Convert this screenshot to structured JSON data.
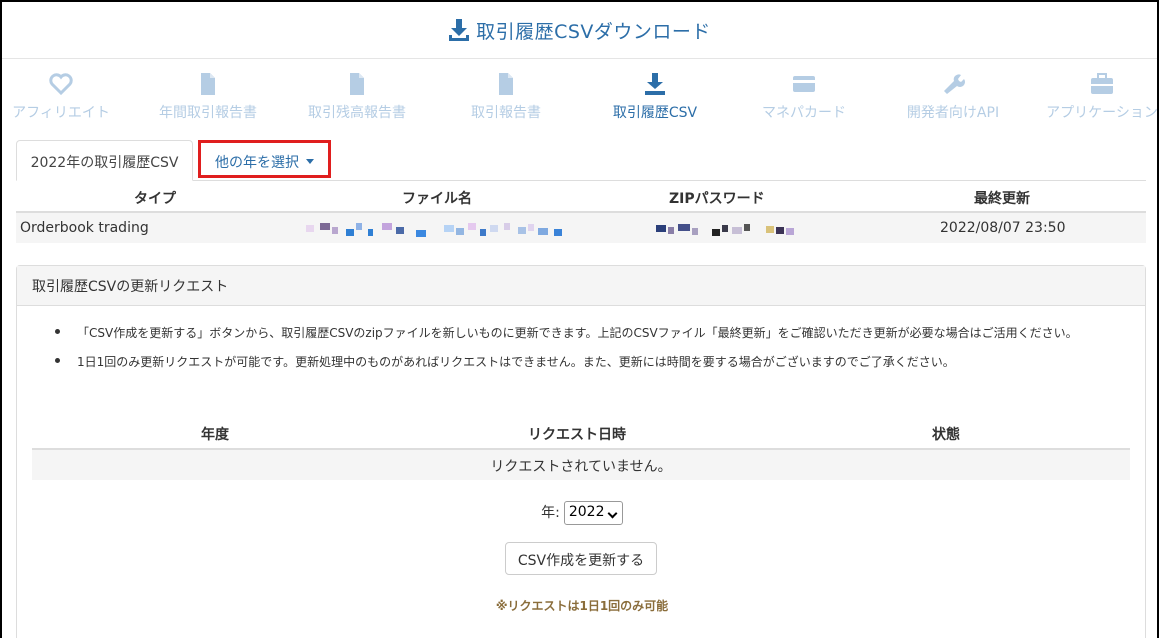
{
  "title": "取引履歴CSVダウンロード",
  "nav": [
    {
      "label": "アフィリエイト",
      "icon": "heart-icon"
    },
    {
      "label": "年間取引報告書",
      "icon": "document-icon"
    },
    {
      "label": "取引残高報告書",
      "icon": "document-icon"
    },
    {
      "label": "取引報告書",
      "icon": "document-icon"
    },
    {
      "label": "取引履歴CSV",
      "icon": "download-icon",
      "active": true
    },
    {
      "label": "マネパカード",
      "icon": "credit-card-icon"
    },
    {
      "label": "開発者向けAPI",
      "icon": "wrench-icon"
    },
    {
      "label": "アプリケーション",
      "icon": "briefcase-icon"
    }
  ],
  "tabs": {
    "active": "2022年の取引履歴CSV",
    "dropdown": "他の年を選択"
  },
  "file_table": {
    "headers": [
      "タイプ",
      "ファイル名",
      "ZIPパスワード",
      "最終更新"
    ],
    "row": {
      "type": "Orderbook trading",
      "filename": "",
      "password": "",
      "updated": "2022/08/07 23:50"
    }
  },
  "request_panel": {
    "title": "取引履歴CSVの更新リクエスト",
    "bullets": [
      "「CSV作成を更新する」ボタンから、取引履歴CSVのzipファイルを新しいものに更新できます。上記のCSVファイル「最終更新」をご確認いただき更新が必要な場合はご活用ください。",
      "1日1回のみ更新リクエストが可能です。更新処理中のものがあればリクエストはできません。また、更新には時間を要する場合がございますのでご了承ください。"
    ],
    "table_headers": [
      "年度",
      "リクエスト日時",
      "状態"
    ],
    "empty_message": "リクエストされていません。",
    "year_label": "年:",
    "year_value": "2022",
    "button": "CSV作成を更新する",
    "note": "※リクエストは1日1回のみ可能"
  },
  "colors": {
    "accent": "#2c6ea8",
    "inactive_nav": "#b5cde4",
    "highlight_border": "#e01e1e",
    "note": "#8a6d3b"
  }
}
